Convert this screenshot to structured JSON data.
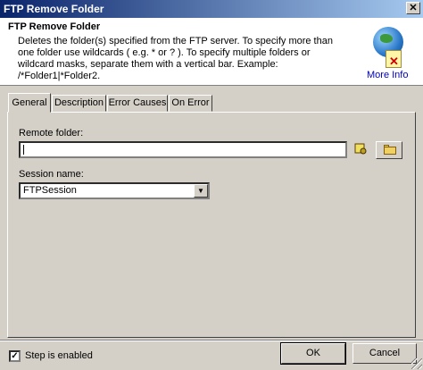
{
  "window": {
    "title": "FTP Remove Folder",
    "close_glyph": "✕"
  },
  "header": {
    "title": "FTP Remove Folder",
    "description": "Deletes the folder(s) specified from the FTP server.  To specify more than one folder use wildcards ( e.g. * or ? ).  To specify multiple folders or wildcard masks, separate them with a vertical bar.  Example: /*Folder1|*Folder2.",
    "more_info": "More Info",
    "icon": "globe-document-x-icon"
  },
  "tabs": [
    {
      "label": "General",
      "active": true
    },
    {
      "label": "Description",
      "active": false
    },
    {
      "label": "Error Causes",
      "active": false
    },
    {
      "label": "On Error",
      "active": false
    }
  ],
  "form": {
    "remote_folder": {
      "label": "Remote folder:",
      "value": ""
    },
    "session_name": {
      "label": "Session name:",
      "value": "FTPSession"
    }
  },
  "footer": {
    "step_enabled_label": "Step is enabled",
    "step_enabled_checked": true,
    "ok_label": "OK",
    "cancel_label": "Cancel"
  },
  "colors": {
    "title_gradient_start": "#0a246a",
    "title_gradient_end": "#a6caf0",
    "face": "#d4d0c8",
    "link": "#0000c0"
  }
}
